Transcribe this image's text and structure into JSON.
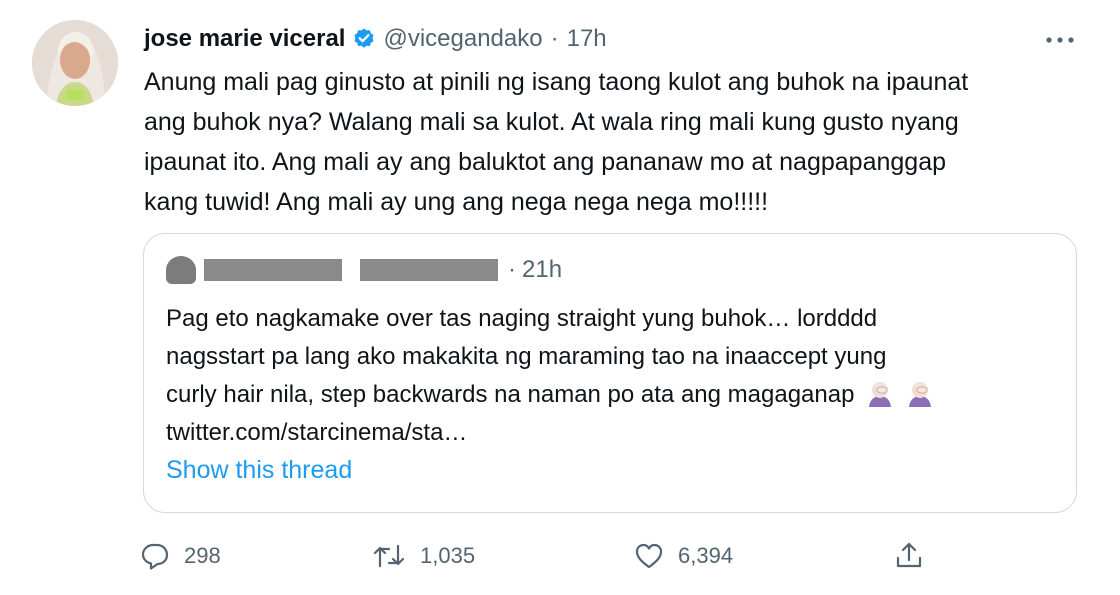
{
  "author": {
    "name": "jose marie viceral",
    "handle": "@vicegandako",
    "time": "17h",
    "separator": "·"
  },
  "tweet_text": "Anung mali pag ginusto at pinili ng isang taong kulot ang buhok na ipaunat\nang buhok nya? Walang mali sa kulot. At wala ring mali kung gusto nyang\nipaunat ito. Ang mali ay ang baluktot ang pananaw mo at nagpapanggap\nkang tuwid! Ang mali ay ung ang nega nega nega mo!!!!!",
  "quoted": {
    "time": "21h",
    "separator": "·",
    "lines": [
      "Pag eto nagkamake over tas naging straight yung buhok… lordddd",
      "nagsstart pa lang ako makakita ng maraming tao na inaaccept yung",
      "curly hair nila, step backwards na naman po ata ang magaganap",
      "twitter.com/starcinema/sta…"
    ],
    "emojis": [
      "person-facepalming-emoji",
      "person-facepalming-emoji"
    ],
    "show_thread": "Show this thread"
  },
  "actions": {
    "replies": "298",
    "retweets": "1,035",
    "likes": "6,394"
  },
  "colors": {
    "text": "#0f1419",
    "secondary": "#536471",
    "accent": "#1d9bf0",
    "border": "#cfd9de",
    "redaction": "#8a8a8a"
  },
  "icons": [
    "verified-badge-icon",
    "more-icon",
    "reply-icon",
    "retweet-icon",
    "like-icon",
    "share-icon"
  ]
}
